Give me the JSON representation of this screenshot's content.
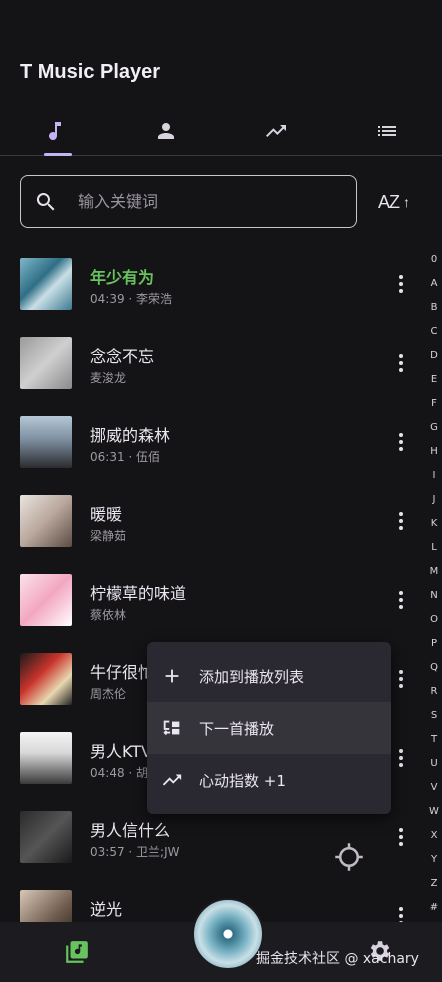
{
  "app": {
    "title": "T Music Player"
  },
  "tabs": [
    {
      "name": "songs",
      "icon": "music-note-icon"
    },
    {
      "name": "artists",
      "icon": "person-icon"
    },
    {
      "name": "trending",
      "icon": "trending-up-icon"
    },
    {
      "name": "playlists",
      "icon": "list-icon"
    }
  ],
  "search": {
    "placeholder": "输入关键词",
    "value": ""
  },
  "sort": {
    "label": "AZ",
    "arrow": "↑"
  },
  "songs": [
    {
      "title": "年少有为",
      "subtitle": "04:39 · 李荣浩",
      "active": true
    },
    {
      "title": "念念不忘",
      "subtitle": "麦浚龙"
    },
    {
      "title": "挪威的森林",
      "subtitle": "06:31 · 伍佰"
    },
    {
      "title": "暖暖",
      "subtitle": "梁静茹"
    },
    {
      "title": "柠檬草的味道",
      "subtitle": "蔡依林"
    },
    {
      "title": "牛仔很忙",
      "subtitle": "周杰伦"
    },
    {
      "title": "男人KTV",
      "subtitle": "04:48 · 胡彦斌"
    },
    {
      "title": "男人信什么",
      "subtitle": "03:57 · 卫兰;JW"
    },
    {
      "title": "逆光",
      "subtitle": ""
    }
  ],
  "alphabet": [
    "0",
    "A",
    "B",
    "C",
    "D",
    "E",
    "F",
    "G",
    "H",
    "I",
    "J",
    "K",
    "L",
    "M",
    "N",
    "O",
    "P",
    "Q",
    "R",
    "S",
    "T",
    "U",
    "V",
    "W",
    "X",
    "Y",
    "Z",
    "#"
  ],
  "context_menu": {
    "items": [
      {
        "label": "添加到播放列表",
        "icon": "plus-icon"
      },
      {
        "label": "下一首播放",
        "icon": "queue-next-icon"
      },
      {
        "label": "心动指数 +1",
        "icon": "trending-up-icon"
      }
    ]
  },
  "watermark": "掘金技术社区 @ xachary",
  "colors": {
    "accent": "#C5B3F5",
    "active_song": "#67C35E",
    "background": "#141316",
    "menu": "#2A2830"
  }
}
